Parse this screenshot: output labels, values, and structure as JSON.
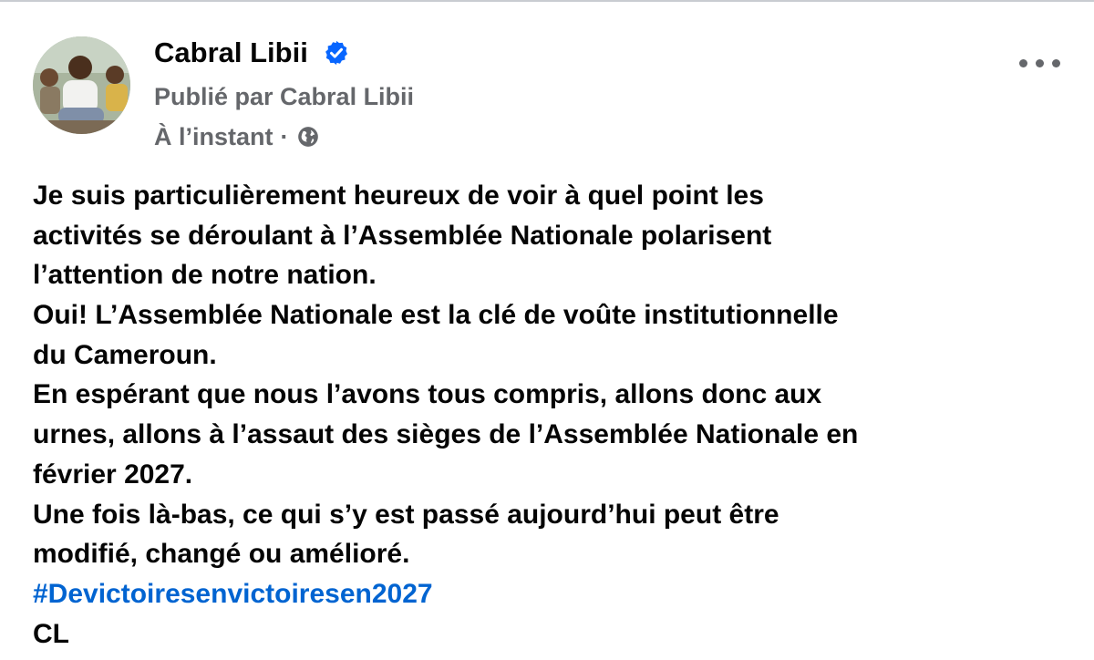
{
  "post": {
    "author": "Cabral Libii",
    "published_by": "Publié par Cabral Libii",
    "timestamp": "À l’instant",
    "separator": "·",
    "audience_icon": "globe-icon",
    "verified_icon": "verified-badge-icon",
    "more_icon": "more-options-icon",
    "body_lines": [
      "Je suis particulièrement heureux de voir à quel point les",
      "activités se déroulant à l’Assemblée Nationale polarisent",
      "l’attention de notre nation.",
      "Oui! L’Assemblée Nationale est la clé de voûte institutionnelle",
      "du Cameroun.",
      "En espérant que nous l’avons tous compris, allons donc aux",
      "urnes, allons à l’assaut des sièges de l’Assemblée Nationale en",
      "février 2027.",
      "Une fois là-bas, ce qui s’y est passé aujourd’hui peut être",
      "modifié, changé ou amélioré."
    ],
    "hashtag": "#Devictoiresenvictoiresen2027",
    "signature": "CL"
  },
  "colors": {
    "text": "#050505",
    "secondary_text": "#65676b",
    "link": "#0064d1",
    "verified": "#0866ff"
  }
}
